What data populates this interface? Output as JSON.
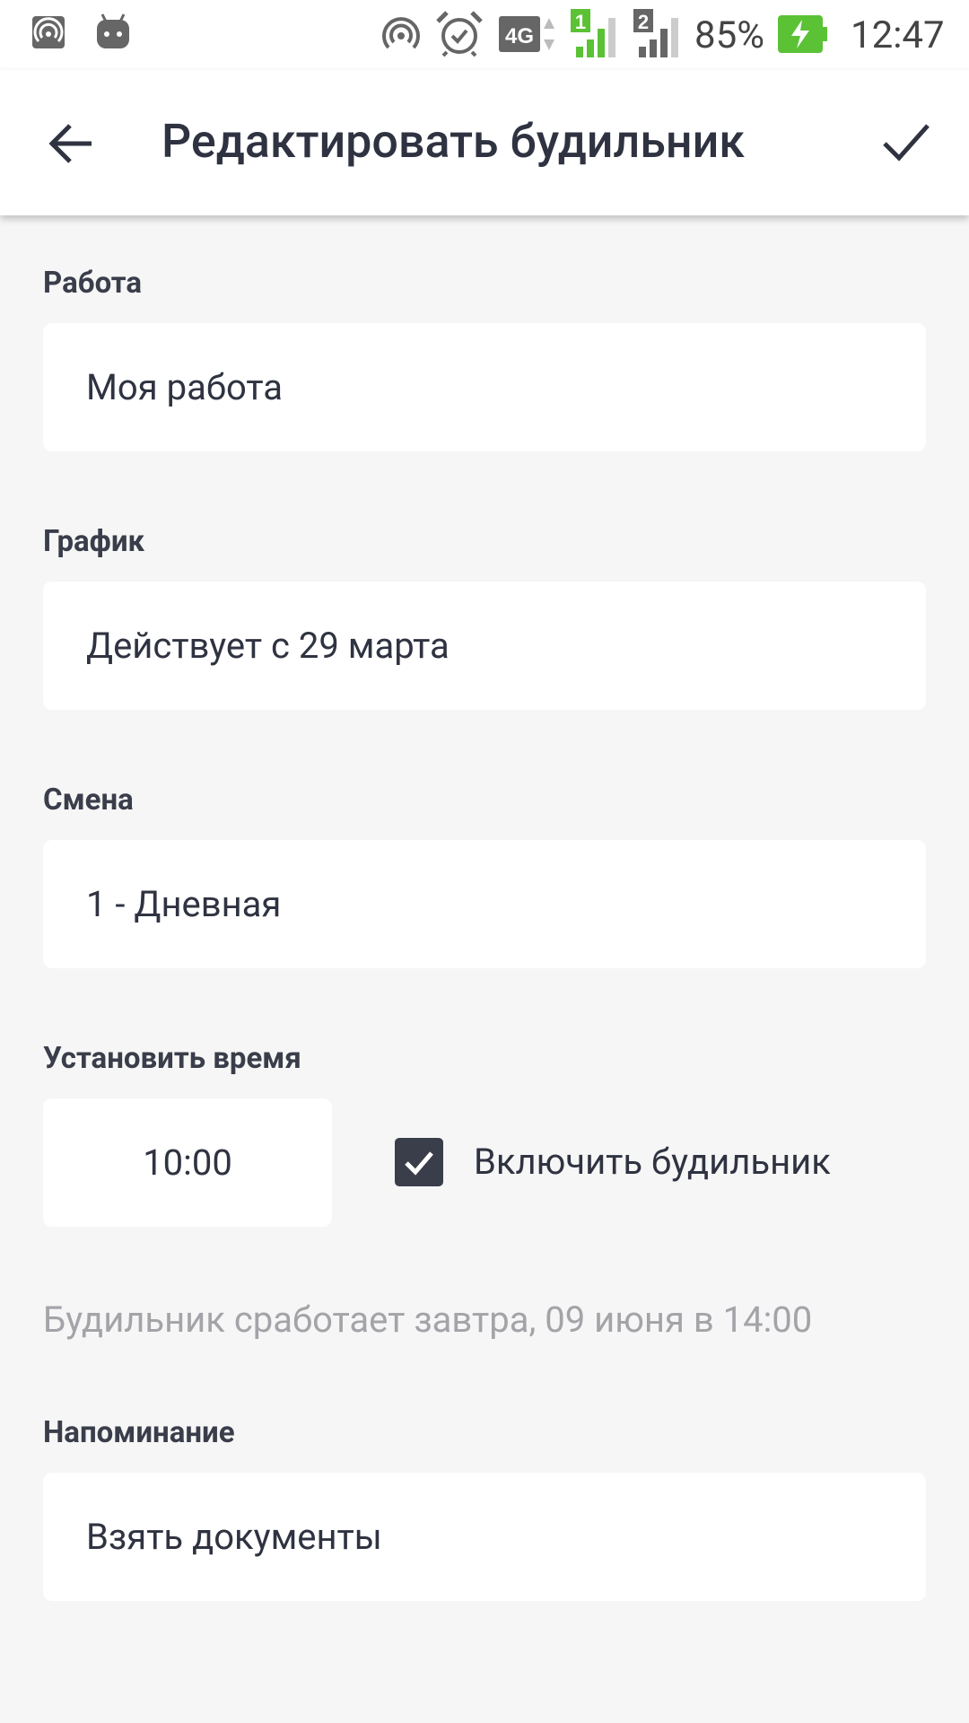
{
  "status_bar": {
    "battery": "85%",
    "time": "12:47",
    "network": "4G",
    "sim1": "1",
    "sim2": "2"
  },
  "appbar": {
    "title": "Редактировать будильник",
    "back_icon": "arrow-back-icon",
    "confirm_icon": "check-icon"
  },
  "form": {
    "work": {
      "label": "Работа",
      "value": "Моя работа"
    },
    "schedule": {
      "label": "График",
      "value": "Действует с 29 марта"
    },
    "shift": {
      "label": "Смена",
      "value": "1 - Дневная"
    },
    "time": {
      "label": "Установить время",
      "value": "10:00",
      "alarm_enabled": true,
      "alarm_label": "Включить будильник"
    },
    "hint": "Будильник сработает завтра, 09 июня в 14:00",
    "reminder": {
      "label": "Напоминание",
      "value": "Взять документы"
    }
  },
  "colors": {
    "background": "#f6f6f6",
    "surface": "#ffffff",
    "text_primary": "#2f3341",
    "text_hint": "#a3a3a8",
    "checkbox": "#3a3d4a",
    "battery_green": "#5bc236",
    "signal_green": "#5bc236"
  }
}
